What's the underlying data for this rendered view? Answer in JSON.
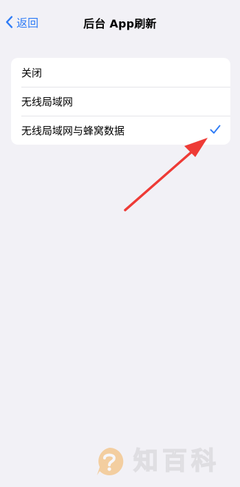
{
  "nav": {
    "back_label": "返回",
    "title": "后台 App刷新"
  },
  "options": [
    {
      "label": "关闭",
      "selected": false
    },
    {
      "label": "无线局域网",
      "selected": false
    },
    {
      "label": "无线局域网与蜂窝数据",
      "selected": true
    }
  ],
  "colors": {
    "accent": "#2f7cf6",
    "background": "#f2f1f6",
    "annotation_arrow": "#ee3b36"
  },
  "icons": {
    "back": "chevron-left-icon",
    "selected": "checkmark-icon",
    "watermark_logo": "question-mark-logo-icon"
  },
  "watermark": {
    "text": "知百科"
  }
}
